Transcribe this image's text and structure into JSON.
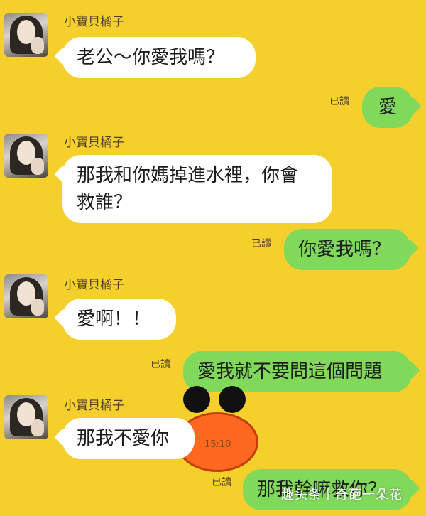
{
  "contact": {
    "name": "小寶貝橘子"
  },
  "read_label": "已讀",
  "messages": [
    {
      "side": "in",
      "text": "老公～你愛我嗎？"
    },
    {
      "side": "out",
      "text": "愛"
    },
    {
      "side": "in",
      "text": "那我和你媽掉進水裡，你會\n救誰？"
    },
    {
      "side": "out",
      "text": "你愛我嗎？"
    },
    {
      "side": "in",
      "text": "愛啊！！"
    },
    {
      "side": "out",
      "text": "愛我就不要問這個問題"
    },
    {
      "side": "in",
      "text": "那我不愛你"
    },
    {
      "side": "out",
      "text": "那我幹嘛救你？"
    }
  ],
  "timestamp": "15:10",
  "watermark": "趣头条丨奇葩一朵花",
  "colors": {
    "background": "#f5cf2b",
    "incoming": "#ffffff",
    "outgoing": "#80d95b",
    "duck_beak": "#ff6820"
  }
}
